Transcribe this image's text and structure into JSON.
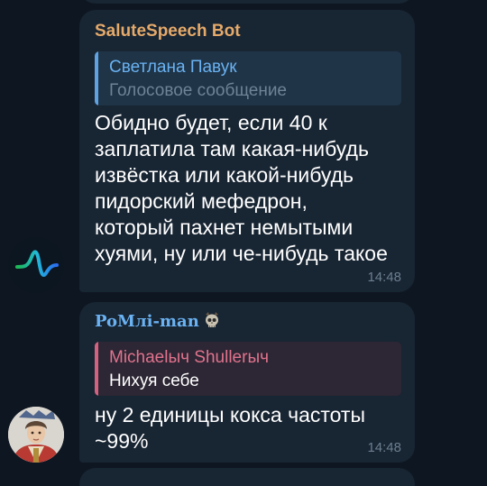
{
  "messages": [
    {
      "sender": "SaluteSpeech Bot",
      "reply": {
        "author": "Светлана Павук",
        "text": "Голосовое сообщение"
      },
      "text_lines": [
        "Обидно будет, если 40 к",
        "заплатила там какая-нибудь",
        "извёстка или какой-нибудь",
        "пидорский мефедрон,",
        "который пахнет немытыми",
        "хуями, ну или че-нибудь такое"
      ],
      "time": "14:48",
      "avatar_icon": "salute-wave-logo-icon"
    },
    {
      "sender": "PoMлi-man",
      "sender_badge_icon": "skull-emoji-icon",
      "reply": {
        "author": "Michaelыч Shullerыч",
        "text": "Нихуя себе"
      },
      "text_lines": [
        "ну 2 единицы кокса частоты",
        "~99%"
      ],
      "time": "14:48",
      "avatar_icon": "portrait-avatar-icon"
    }
  ],
  "colors": {
    "background": "#0e1621",
    "bubble": "#182533",
    "sender1": "#e5aa6a",
    "sender2": "#6ab2f2",
    "reply_accent_blue": "#5fa2df",
    "reply_accent_pink": "#d4627f"
  }
}
